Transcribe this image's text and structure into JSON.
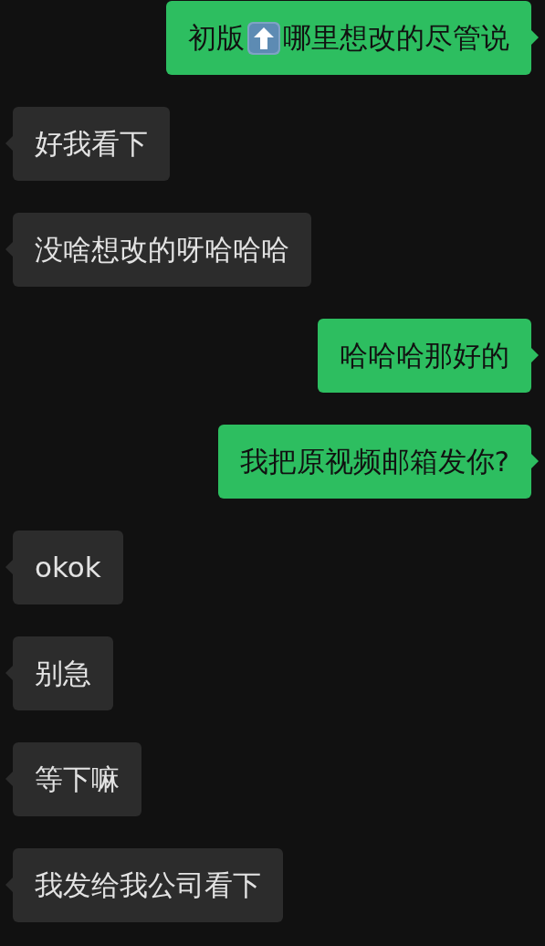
{
  "messages": [
    {
      "kind": "sent",
      "parts": [
        {
          "kind": "text",
          "text": "初版"
        },
        {
          "kind": "emoji"
        },
        {
          "kind": "text",
          "text": "哪里想改的尽管说"
        }
      ]
    },
    {
      "kind": "received",
      "text": "好我看下"
    },
    {
      "kind": "received",
      "text": "没啥想改的呀哈哈哈"
    },
    {
      "kind": "sent",
      "text": "哈哈哈那好的"
    },
    {
      "kind": "sent",
      "text": "我把原视频邮箱发你?"
    },
    {
      "kind": "received",
      "text": "okok"
    },
    {
      "kind": "received",
      "text": "别急"
    },
    {
      "kind": "received",
      "text": "等下嘛"
    },
    {
      "kind": "received",
      "text": "我发给我公司看下"
    }
  ]
}
